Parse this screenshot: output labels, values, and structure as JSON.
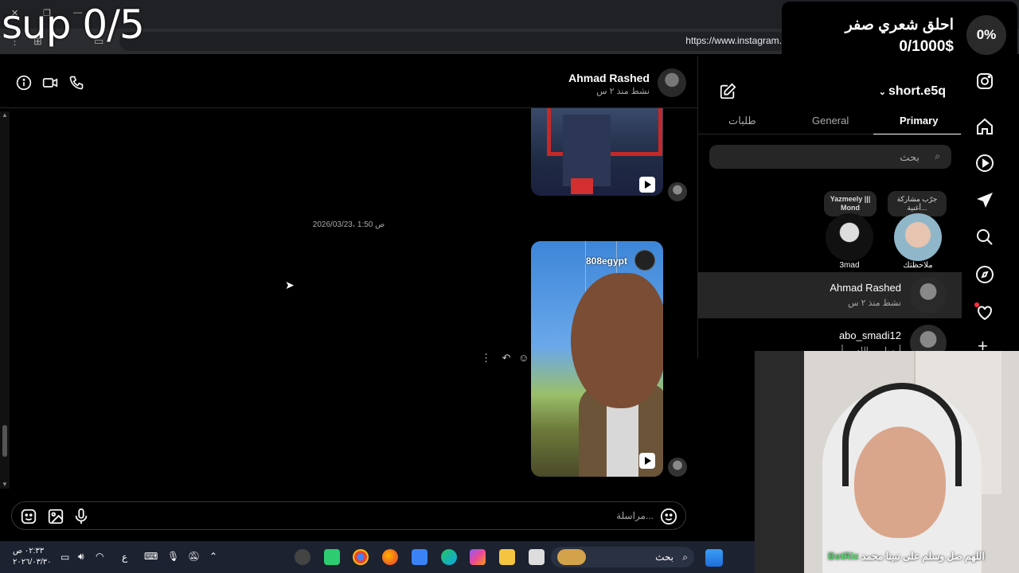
{
  "overlay": {
    "title": "sup 0/5"
  },
  "goal": {
    "title": "احلق شعري صفر",
    "amount": "0/1000$",
    "progress_label": "0%",
    "progress": 0
  },
  "browser": {
    "url": "https://www.instagram."
  },
  "chat": {
    "header": {
      "name": "Ahmad Rashed",
      "status": "نشط منذ ٢ س"
    },
    "timestamp": "2026/03/23، 1:50 ص",
    "video_user": "808egypt",
    "composer_placeholder": "مراسلة..."
  },
  "dm": {
    "account": "short.e5q",
    "tabs": [
      "Primary",
      "General",
      "طلبات"
    ],
    "search_placeholder": "بحث",
    "notes": [
      {
        "text": "جرّب مشاركة أغنية...",
        "name": "ملاحظتك"
      },
      {
        "text": "Yazmeely ||| Mond",
        "name": "3mad"
      }
    ],
    "conversations": [
      {
        "name": "Ahmad Rashed",
        "sub": "نشط منذ ٢ س"
      },
      {
        "name": "abo_smadi12",
        "sub": "أرسل ... الله ... أ"
      }
    ]
  },
  "stream": {
    "ticker": "اللهم صل وسلم على نبينا محمد",
    "bot": "BotRix"
  },
  "taskbar": {
    "search": "بحث",
    "time": "٠٢:٣٣ ص",
    "date": "٢٠٢٦/٠٣/٣٠",
    "lang": "ع"
  },
  "colors": {
    "accent_red": "#ff3040",
    "bg": "#000000",
    "surface": "#262626",
    "bot_green": "#4cd964"
  }
}
